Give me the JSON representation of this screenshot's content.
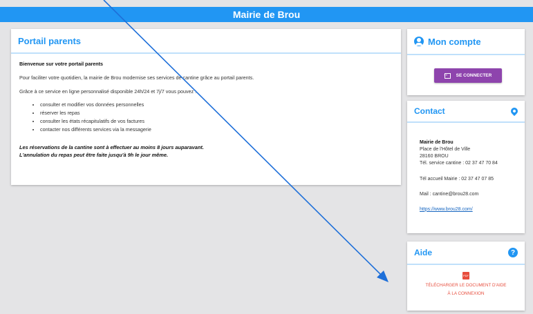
{
  "header": {
    "title": "Mairie de Brou"
  },
  "portal": {
    "title": "Portail parents",
    "welcome": "Bienvenue sur votre portail parents",
    "intro": "Pour faciliter votre quotidien, la mairie de Brou modernise ses services de cantine grâce au portail parents.",
    "lead": "Grâce à ce service en ligne personnalisé disponible 24h/24 et 7j/7 vous pouvez :",
    "items": [
      "consulter et modifier vos données personnelles",
      "réserver les repas",
      "consulter les états récapitulatifs de vos factures",
      "contacter nos différents services via la messagerie"
    ],
    "note1": "Les réservations de la cantine sont à effectuer au moins 8 jours auparavant.",
    "note2": "L'annulation du repas peut être faite jusqu'à 9h le jour même."
  },
  "account": {
    "title": "Mon compte",
    "login_label": "SE CONNECTER"
  },
  "contact": {
    "title": "Contact",
    "name": "Mairie de Brou",
    "address1": "Place de l'Hôtel de Ville",
    "address2": "28160 BROU",
    "phone_canteen": "Tél. service cantine : 02 37 47 70 84",
    "phone_reception": "Tél accueil Mairie : 02 37 47 07 85",
    "email": "Mail : cantine@brou28.com",
    "website": "https://www.brou28.com/"
  },
  "help": {
    "title": "Aide",
    "download_line1": "TÉLÉCHARGER LE DOCUMENT D'AIDE",
    "download_line2": "À LA CONNEXION"
  },
  "colors": {
    "primary": "#2196f3",
    "login_button": "#8e44ad",
    "download": "#e74c3c",
    "background": "#e4e4e6"
  },
  "icons": [
    "user-circle-icon",
    "login-icon",
    "location-pin-icon",
    "question-icon",
    "pdf-icon",
    "annotation-arrow"
  ]
}
